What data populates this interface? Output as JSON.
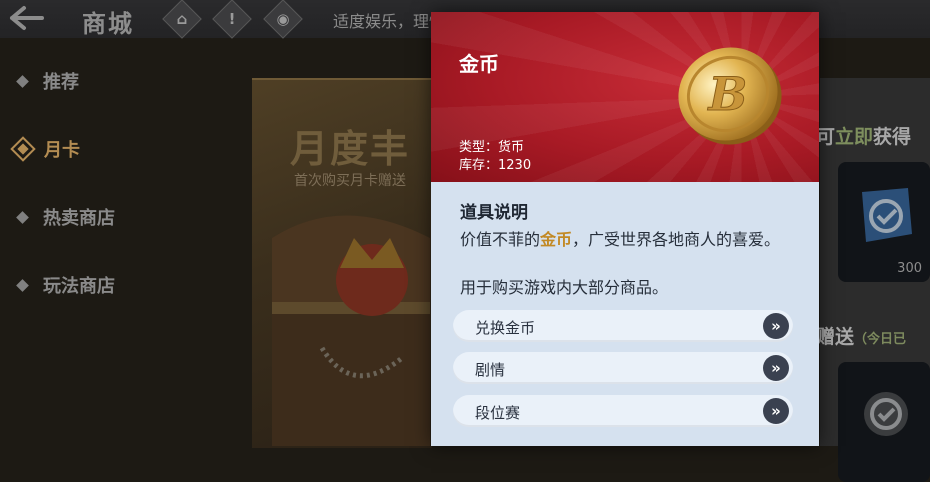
{
  "background": {
    "shop_title": "商城",
    "notice": "适度娱乐，理性消费",
    "top_icons": [
      "home-icon",
      "alert-icon",
      "chat-icon"
    ],
    "sidebar": [
      {
        "label": "推荐",
        "active": false
      },
      {
        "label": "月卡",
        "active": true
      },
      {
        "label": "热卖商店",
        "active": false
      },
      {
        "label": "玩法商店",
        "active": false
      }
    ],
    "banner": {
      "title": "月度丰",
      "subtitle": "首次购买月卡赠送"
    },
    "right": {
      "label_pre": "可",
      "label_hl": "立即",
      "label_post": "获得",
      "card_qty": "300",
      "label2": "赠送",
      "label2_small": "（今日已"
    }
  },
  "popup": {
    "item_name": "金币",
    "type_line": "类型：货币",
    "stock_line": "库存：1230",
    "desc_title": "道具说明",
    "desc_pre": "价值不菲的",
    "desc_highlight": "金币",
    "desc_post": "，广受世界各地商人的喜爱。",
    "desc_line2": "用于购买游戏内大部分商品。",
    "sources": [
      {
        "label": "兑换金币"
      },
      {
        "label": "剧情"
      },
      {
        "label": "段位赛"
      }
    ],
    "colors": {
      "header": "#a81a25",
      "body": "#d5e1ef",
      "highlight": "#c28924"
    }
  }
}
